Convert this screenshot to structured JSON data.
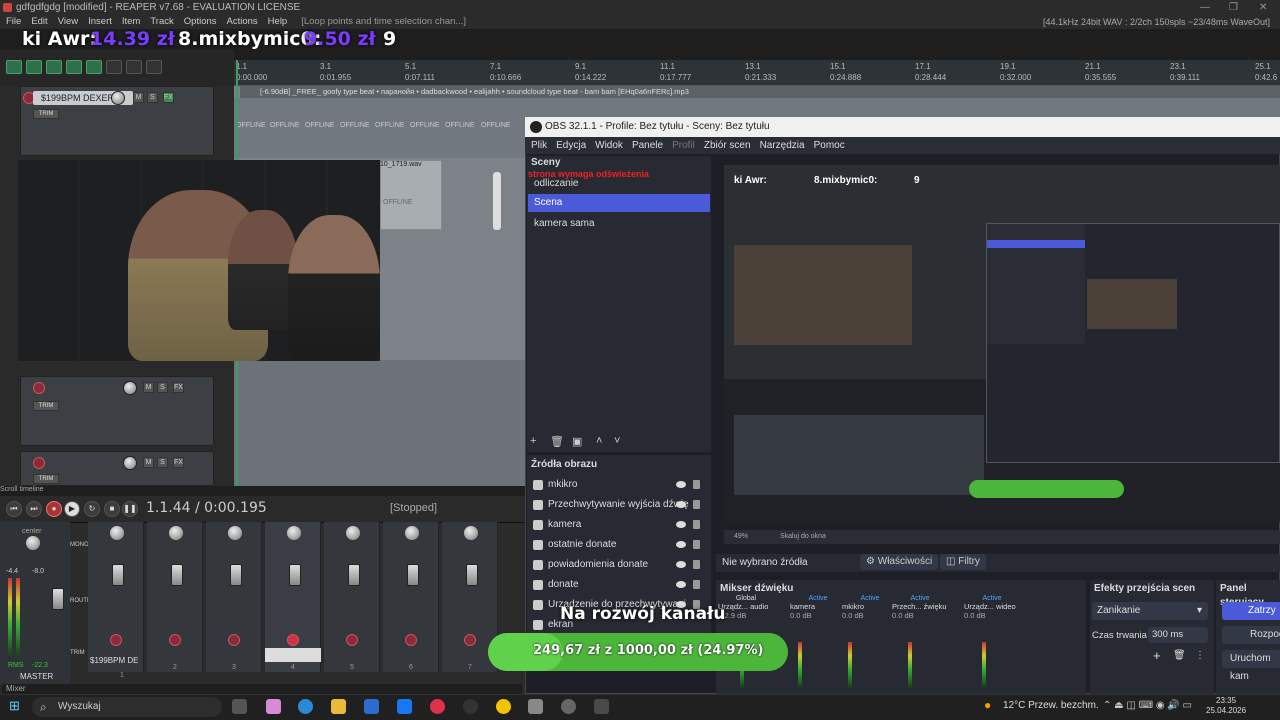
{
  "reaper": {
    "window_title": "gdfgdfgdg [modified] - REAPER v7.68 - EVALUATION LICENSE",
    "menu": [
      "File",
      "Edit",
      "View",
      "Insert",
      "Item",
      "Track",
      "Options",
      "Actions",
      "Help"
    ],
    "loop_hint": "[Loop points and time selection chan...]",
    "status": "[44.1kHz 24bit WAV : 2/2ch 150spls ~23/48ms WaveOut]",
    "overlay_left": "ki Awr:",
    "overlay_amount1": "14.39 zł",
    "overlay_mid": "8.mixbymic0:",
    "overlay_amount2": "9.50 zł",
    "overlay_right": "9",
    "ruler": [
      "1.1",
      "3.1",
      "5.1",
      "7.1",
      "9.1",
      "11.1",
      "13.1",
      "15.1",
      "17.1",
      "19.1",
      "21.1",
      "23.1",
      "25.1"
    ],
    "ruler_sub": [
      "0:00.000",
      "0:01.955",
      "0:07.111",
      "0:10.666",
      "0:14.222",
      "0:17.777",
      "0:21.333",
      "0:24.888",
      "0:28.444",
      "0:32.000",
      "0:35.555",
      "0:39.111",
      "0:42.6"
    ],
    "item_name": "[-6.90dB] _FREE_ goofy type beat • паранойя • dadbackwood • ealijahh • soundcloud type beat - bam bam [EHq0a6nFERc].mp3",
    "offline": "OFFLINE",
    "wav_name": "10_1719.wav",
    "track1_name": "$199BPM DEXER",
    "track_buttons": [
      "M",
      "S",
      "FX"
    ],
    "trim": "TRIM",
    "timeline_label": "Scroll timeline",
    "time": "1.1.44 / 0:00.195",
    "transport_state": "[Stopped]",
    "master": {
      "label": "MASTER",
      "center": "center",
      "rms": "RMS",
      "rms_val": "-22.3",
      "db1": "-4.4",
      "db2": "-8.0",
      "mono": "MONO",
      "route": "ROUTE",
      "trim": "TRIM"
    },
    "mixer_track_name": "$199BPM DE",
    "mixer_numbers": [
      "1",
      "2",
      "3",
      "4",
      "5",
      "6",
      "7"
    ],
    "mixer_label": "Mixer"
  },
  "obs": {
    "title": "OBS 32.1.1 - Profile: Bez tytułu - Sceny: Bez tytułu",
    "menu": [
      "Plik",
      "Edycja",
      "Widok",
      "Panele",
      "Profil",
      "Zbiór scen",
      "Narzędzia",
      "Pomoc"
    ],
    "scenes_header": "Sceny",
    "scenes": [
      "odliczanie",
      "Scena",
      "kamera sama"
    ],
    "scene_selected": 1,
    "red_overlay": "strona wymaga odświeżenia",
    "sources_header": "Źródła obrazu",
    "sources": [
      "mkikro",
      "Przechwytywanie wyjścia dźwię",
      "kamera",
      "ostatnie donate",
      "powiadomienia donate",
      "donate",
      "Urządzenie do przechwytywani",
      "ekran"
    ],
    "no_source": "Nie wybrano źródła",
    "properties": "Właściwości",
    "filters": "Filtry",
    "audio_mixer": "Mikser dźwięku",
    "audio_cols": [
      {
        "state": "Global",
        "name": "Urządz... audio",
        "db": "-12.9 dB"
      },
      {
        "state": "Active",
        "name": "kamera",
        "db": "0.0 dB"
      },
      {
        "state": "Active",
        "name": "mkikro",
        "db": "0.0 dB"
      },
      {
        "state": "Active",
        "name": "Przech... źwięku",
        "db": "0.0 dB"
      },
      {
        "state": "Active",
        "name": "Urządz... wideo",
        "db": "0.0 dB"
      }
    ],
    "transitions_header": "Efekty przejścia scen",
    "transition": "Zanikanie",
    "duration_label": "Czas trwania",
    "duration": "300 ms",
    "control_header": "Panel sterujący",
    "control_buttons": [
      "Zatrzy",
      "Rozpoc",
      "Uruchom kam"
    ],
    "preview_zoom": "49%",
    "preview_scale": "Skaluj do okna"
  },
  "donate": {
    "title": "Na rozwój kanału",
    "current": "249,67 zł",
    "of": "z",
    "goal": "1000,00 zł",
    "percent_label": "(24.97%)",
    "fraction": 0.2497
  },
  "taskbar": {
    "search": "Wyszukaj",
    "weather": "12°C  Przew. bezchm.",
    "time": "23:35",
    "date": "25.04.2026"
  },
  "colors": {
    "accent_purple": "#7a3cff",
    "obs_selected": "#4a5ad9",
    "donate_green": "#5fd14a"
  }
}
